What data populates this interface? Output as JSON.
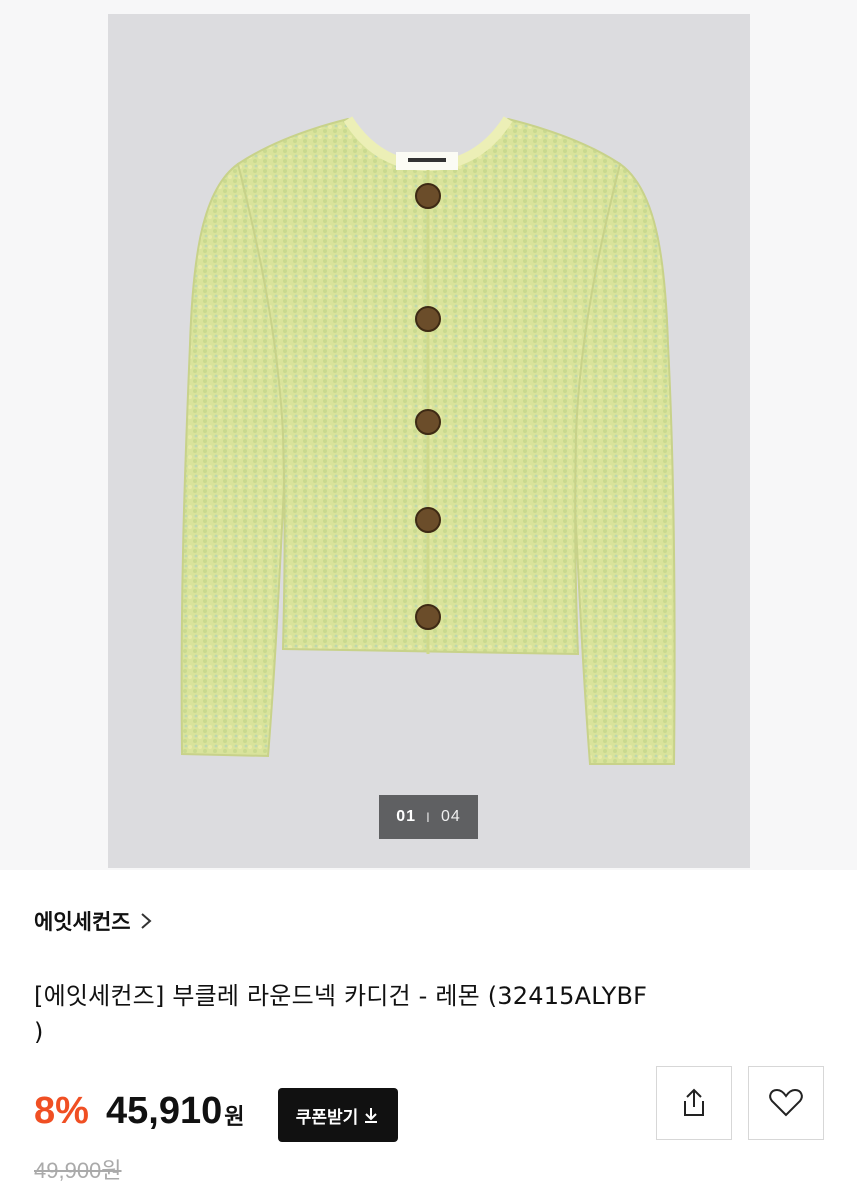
{
  "gallery": {
    "current": "01",
    "separator": "I",
    "total": "04",
    "image_alt": "knit-cardigan-photo"
  },
  "product": {
    "brand": "에잇세컨즈",
    "title_line1": "[에잇세컨즈] 부클레 라운드넥 카디건 - 레몬 (32415ALYBF",
    "title_line2": ")",
    "discount": "8%",
    "price": "45,910",
    "price_unit": "원",
    "original_price": "49,900원"
  },
  "actions": {
    "coupon_label": "쿠폰받기"
  },
  "icons": {
    "brand_chevron": "chevron-right-icon",
    "coupon_download": "download-icon",
    "share": "share-icon",
    "wishlist": "heart-icon"
  },
  "colors": {
    "discount": "#f04f23",
    "coupon_bg": "#111111",
    "photo_bg": "#dcdcdf",
    "cardigan": "#d8e39a"
  }
}
